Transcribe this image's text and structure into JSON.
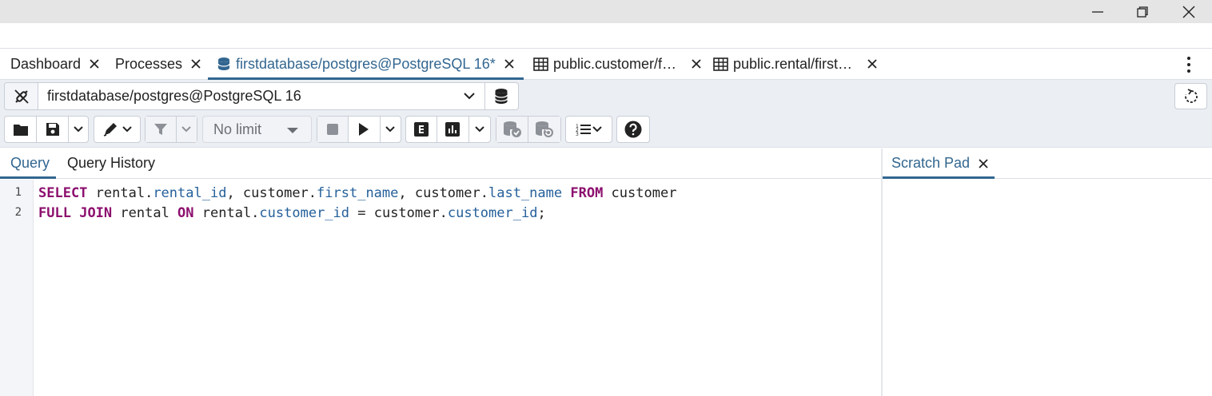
{
  "window": {
    "controls": [
      "minimize",
      "maximize",
      "close"
    ]
  },
  "tabs": [
    {
      "label": "Dashboard",
      "icon": "none",
      "active": false
    },
    {
      "label": "Processes",
      "icon": "none",
      "active": false
    },
    {
      "label": "firstdatabase/postgres@PostgreSQL 16*",
      "icon": "database-icon",
      "active": true
    },
    {
      "label": "public.customer/f…",
      "icon": "table-icon",
      "active": false
    },
    {
      "label": "public.rental/first…",
      "icon": "table-icon",
      "active": false
    }
  ],
  "connection": {
    "value": "firstdatabase/postgres@PostgreSQL 16"
  },
  "toolbar": {
    "limit_value": "No limit"
  },
  "query_tabs": {
    "query": "Query",
    "history": "Query History"
  },
  "editor": {
    "line_numbers": [
      "1",
      "2"
    ]
  },
  "scratch": {
    "title": "Scratch Pad"
  },
  "colors": {
    "accent": "#326690",
    "keyword": "#8c0f6e",
    "property": "#25609a"
  }
}
